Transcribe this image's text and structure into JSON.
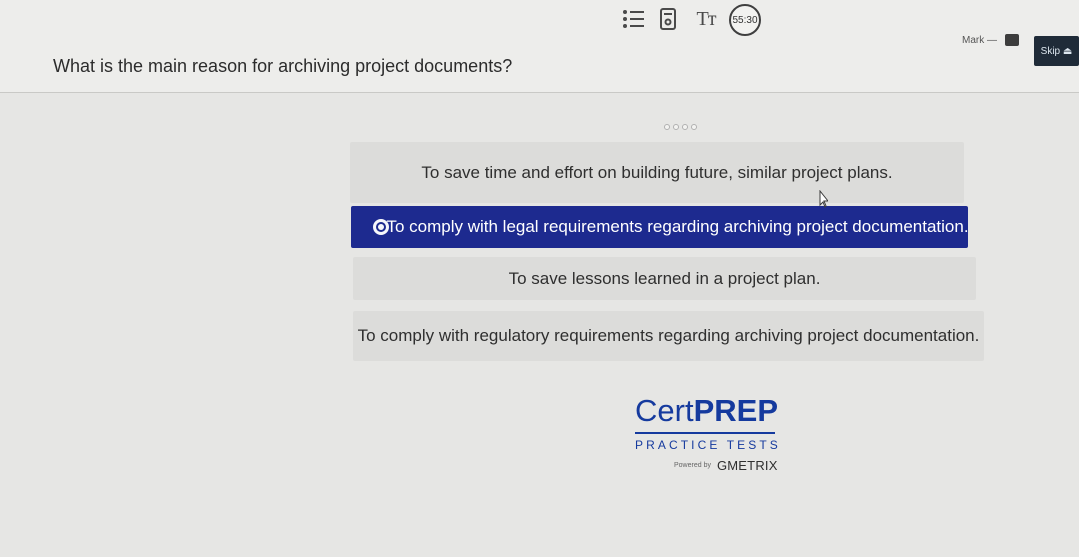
{
  "toolbar": {
    "list_icon": "list-icon",
    "calculator_icon": "calculator-icon",
    "text_size_icon": "text-size-icon",
    "text_size_label": "Tт",
    "timer_label": "55:30"
  },
  "header": {
    "question": "What is the main reason for archiving project documents?",
    "mark_label": "Mark —",
    "skip_label": "Skip ⏏"
  },
  "progress": {
    "dot_count": 4
  },
  "options": [
    {
      "label": "To save time and effort on building future, similar project plans.",
      "selected": false
    },
    {
      "label": "To comply with legal requirements regarding archiving project documentation.",
      "selected": true
    },
    {
      "label": "To save lessons learned in a project plan.",
      "selected": false
    },
    {
      "label": "To comply with regulatory requirements regarding archiving project documentation.",
      "selected": false
    }
  ],
  "branding": {
    "logo_main_thin": "Cert",
    "logo_main_bold": "PREP",
    "logo_sub": "PRACTICE TESTS",
    "powered_prefix": "Powered by",
    "powered_name": "GMETRIX"
  },
  "colors": {
    "selected_option": "#1d2a8f",
    "option_background": "#dcdcda",
    "logo_blue": "#153a9e",
    "skip_background": "#1f2b38"
  }
}
